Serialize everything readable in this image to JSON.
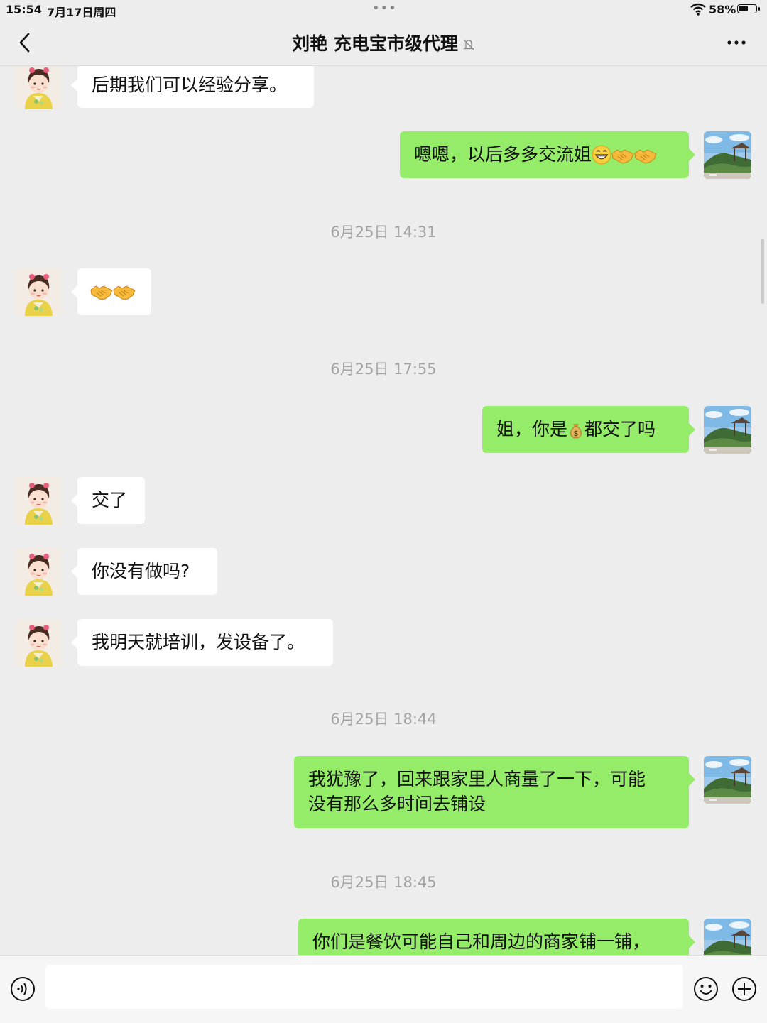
{
  "status_bar": {
    "time": "15:54",
    "date": "7月17日周四",
    "dots": "•••",
    "battery_percent": "58%",
    "battery_level": 0.58
  },
  "header": {
    "title": "刘艳 充电宝市级代理",
    "back_icon": "chevron-left-icon",
    "mute_icon": "bell-slash-icon",
    "more_icon": "ellipsis-icon"
  },
  "messages": {
    "m1": {
      "sender": "contact",
      "text": "后期我们可以经验分享。"
    },
    "m2": {
      "sender": "me",
      "text": "嗯嗯，以后多多交流姐",
      "emojis": [
        "grin-emoji",
        "handshake-emoji",
        "handshake-emoji"
      ]
    },
    "t1": "6月25日 14:31",
    "m3": {
      "sender": "contact",
      "emojis": [
        "handshake-emoji",
        "handshake-emoji"
      ]
    },
    "t2": "6月25日 17:55",
    "m4": {
      "sender": "me",
      "text_before": "姐，你是",
      "emoji": "money-bag-emoji",
      "text_after": "都交了吗"
    },
    "m5": {
      "sender": "contact",
      "text": "交了"
    },
    "m6": {
      "sender": "contact",
      "text": "你没有做吗?"
    },
    "m7": {
      "sender": "contact",
      "text": "我明天就培训，发设备了。"
    },
    "t3": "6月25日 18:44",
    "m8": {
      "sender": "me",
      "line1": "我犹豫了，回来跟家里人商量了一下，可能",
      "line2": "没有那么多时间去铺设"
    },
    "t4": "6月25日 18:45",
    "m9": {
      "sender": "me",
      "text": "你们是餐饮可能自己和周边的商家铺一铺，"
    }
  },
  "input_bar": {
    "voice_icon": "voice-icon",
    "emoji_icon": "smiley-icon",
    "plus_icon": "plus-circle-icon",
    "value": ""
  },
  "colors": {
    "chat_background": "#ededed",
    "incoming_bubble": "#ffffff",
    "outgoing_bubble": "#95ec69",
    "timestamp": "#a2a2a2"
  }
}
